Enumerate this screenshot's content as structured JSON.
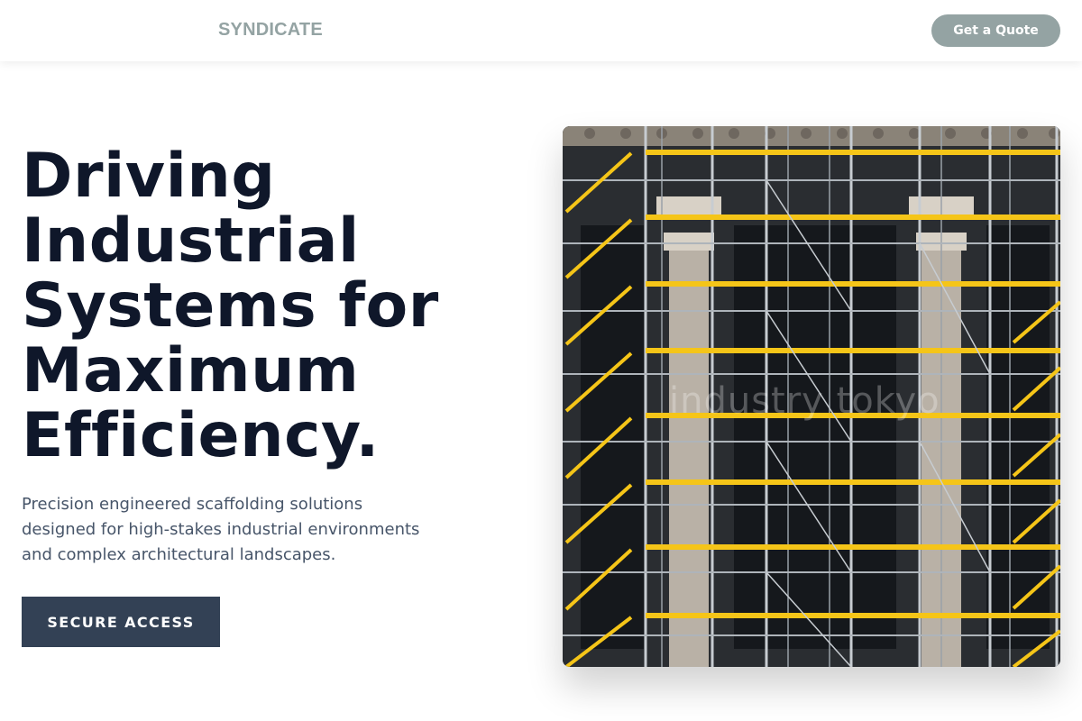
{
  "nav": {
    "logo": "SYNDICATE",
    "cta_label": "Get a Quote"
  },
  "hero": {
    "title_lines": [
      "Driving",
      "Industrial",
      "Systems for",
      "Maximum",
      "Efficiency."
    ],
    "subtitle_lines": [
      "Precision engineered scaffolding solutions",
      "designed for high-stakes industrial environments",
      "and complex architectural landscapes."
    ],
    "button_label": "SECURE ACCESS"
  },
  "image": {
    "watermark": "industry tokyo"
  },
  "colors": {
    "accent": "#94a3a3",
    "title": "#0f172a",
    "body_text": "#475569",
    "button_dark": "#334155",
    "scaffold_yellow": "#f5c518"
  },
  "icons": []
}
